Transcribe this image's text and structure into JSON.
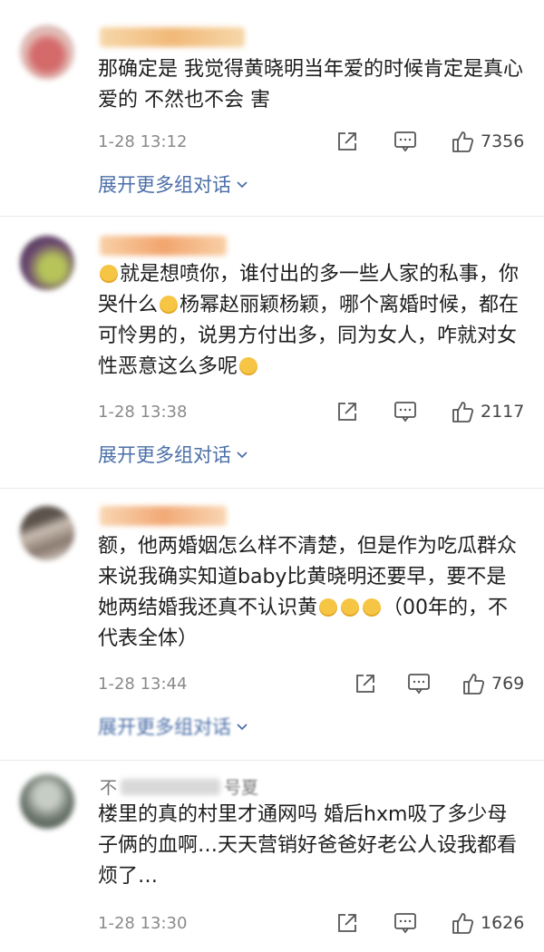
{
  "comments": [
    {
      "text": "那确定是 我觉得黄晓明当年爱的时候肯定是真心爱的 不然也不会 害",
      "time": "1-28 13:12",
      "likes": "7356",
      "expand": "展开更多组对话",
      "avatar_color": "#c98a8a",
      "name_color": "#f2c18a"
    },
    {
      "text_parts": [
        "就是想喷你，谁付出的多一些人家的私事，你哭什么",
        "杨幂赵丽颖杨颖，哪个离婚时候，都在可怜男的，说男方付出多，同为女人，咋就对女性恶意这么多呢"
      ],
      "time": "1-28 13:38",
      "likes": "2117",
      "expand": "展开更多组对话",
      "avatar_color": "#7a5a7d",
      "name_color": "#f4b98a"
    },
    {
      "text_parts": [
        "额，他两婚姻怎么样不清楚，但是作为吃瓜群众来说我确实知道baby比黄晓明还要早，要不是她两结婚我还真不认识黄",
        "（00年的，不代表全体）"
      ],
      "time": "1-28 13:44",
      "likes": "769",
      "expand": "展开更多组对话",
      "avatar_color": "#8a7a70",
      "name_color": "#f3bb8c"
    },
    {
      "name_visible": "不",
      "name_tail": "号夏",
      "text": "楼里的真的村里才通网吗 婚后hxm吸了多少母子俩的血啊…天天营销好爸爸好老公人设我都看烦了…",
      "time": "1-28 13:30",
      "likes": "1626",
      "avatar_color": "#5e6a60",
      "name_color": "#c9c9c9"
    }
  ],
  "icons": {
    "share": "share-icon",
    "comment": "comment-icon",
    "like": "like-icon",
    "expand": "chevron-down-icon",
    "emoji": "emoji-icon"
  },
  "colors": {
    "link": "#4b6fa8",
    "meta": "#8a8a8a",
    "text": "#1e1e1e"
  }
}
